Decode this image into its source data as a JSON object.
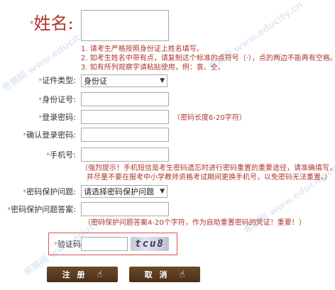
{
  "form": {
    "name_label": "姓名:",
    "name_value": "",
    "name_hints": [
      "1. 请考生严格按照身份证上姓名填写。",
      "2. 如考生姓名中带有点，请复制这个标准的点符号（·），点的两边不能再有空格。",
      "3. 如有所列观察字请粘贴使用，例：袁、仝。"
    ],
    "id_type_label": "证件类型:",
    "id_type_value": "身份证",
    "id_number_label": "身份证号:",
    "password_label": "登录密码:",
    "password_hint": "（密码长度6-20字符）",
    "confirm_password_label": "确认登录密码:",
    "mobile_label": "手机号:",
    "mobile_hint_line1": "（强烈提示！手机短信是考生密码遗忘时进行密码重置的重要途径，请准确填写，",
    "mobile_hint_line2": "并尽量不要在报考中小学教师资格考试期间更换手机号，以免密码无法重置。）",
    "question_label": "密码保护问题:",
    "question_value": "请选择密码保护问题",
    "answer_label": "密码保护问题答案:",
    "answer_hint": "（密码保护问题答案4-20个字符，作为自助重置密码的凭证！重要！）",
    "captcha_label": "验证码",
    "captcha_text": "tcu8",
    "required_mark": "*"
  },
  "buttons": {
    "register": "注 册",
    "cancel": "取 消",
    "hand_icon": "☝"
  },
  "watermark": {
    "text": "希赛网 www.educity.cn"
  },
  "colors": {
    "accent_red": "#b5332a",
    "button_brown": "#5a3b1f"
  }
}
